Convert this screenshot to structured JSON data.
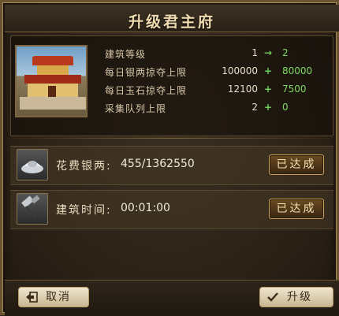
{
  "dialog": {
    "title": "升级君主府"
  },
  "stats": [
    {
      "label": "建筑等级",
      "current": "1",
      "op": "→",
      "next": "2"
    },
    {
      "label": "每日银两掠夺上限",
      "current": "100000",
      "op": "+",
      "next": "80000"
    },
    {
      "label": "每日玉石掠夺上限",
      "current": "12100",
      "op": "+",
      "next": "7500"
    },
    {
      "label": "采集队列上限",
      "current": "2",
      "op": "+",
      "next": "0"
    }
  ],
  "costs": [
    {
      "label": "花费银两:",
      "value": "455/1362550",
      "button": "已达成",
      "icon": "silver-ingot-icon"
    },
    {
      "label": "建筑时间:",
      "value": "00:01:00",
      "button": "已达成",
      "icon": "hammer-icon"
    }
  ],
  "footer": {
    "cancel_label": "取消",
    "upgrade_label": "升级"
  },
  "colors": {
    "accent_gold": "#c9a05a",
    "increase_green": "#6fcf5a",
    "title_text": "#f0dcb0"
  }
}
